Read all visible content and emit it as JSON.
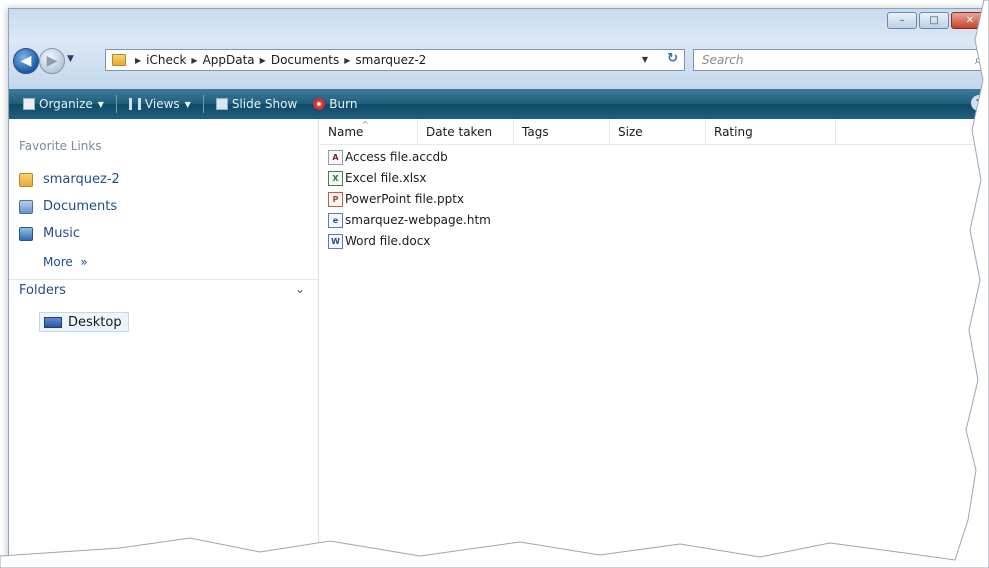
{
  "window_controls": {
    "minimize": "–",
    "maximize": "□",
    "close": "✕"
  },
  "address": {
    "crumbs": [
      "iCheck",
      "AppData",
      "Documents",
      "smarquez-2"
    ]
  },
  "search": {
    "placeholder": "Search"
  },
  "toolbar": {
    "organize": "Organize",
    "views": "Views",
    "slideshow": "Slide Show",
    "burn": "Burn"
  },
  "nav": {
    "favorite_heading": "Favorite Links",
    "favorites": [
      "smarquez-2",
      "Documents",
      "Music"
    ],
    "more": "More",
    "folders_label": "Folders",
    "desktop": "Desktop"
  },
  "files": {
    "columns": [
      "Name",
      "Date taken",
      "Tags",
      "Size",
      "Rating"
    ],
    "items": [
      {
        "name": "Access file.accdb",
        "type": "access"
      },
      {
        "name": "Excel file.xlsx",
        "type": "excel"
      },
      {
        "name": "PowerPoint file.pptx",
        "type": "powerpoint"
      },
      {
        "name": "smarquez-webpage.htm",
        "type": "web"
      },
      {
        "name": "Word file.docx",
        "type": "word"
      }
    ]
  },
  "colors": {
    "toolbar": "#1f5d7c",
    "link": "#1f4d8a",
    "glass": "#c8dbee"
  }
}
